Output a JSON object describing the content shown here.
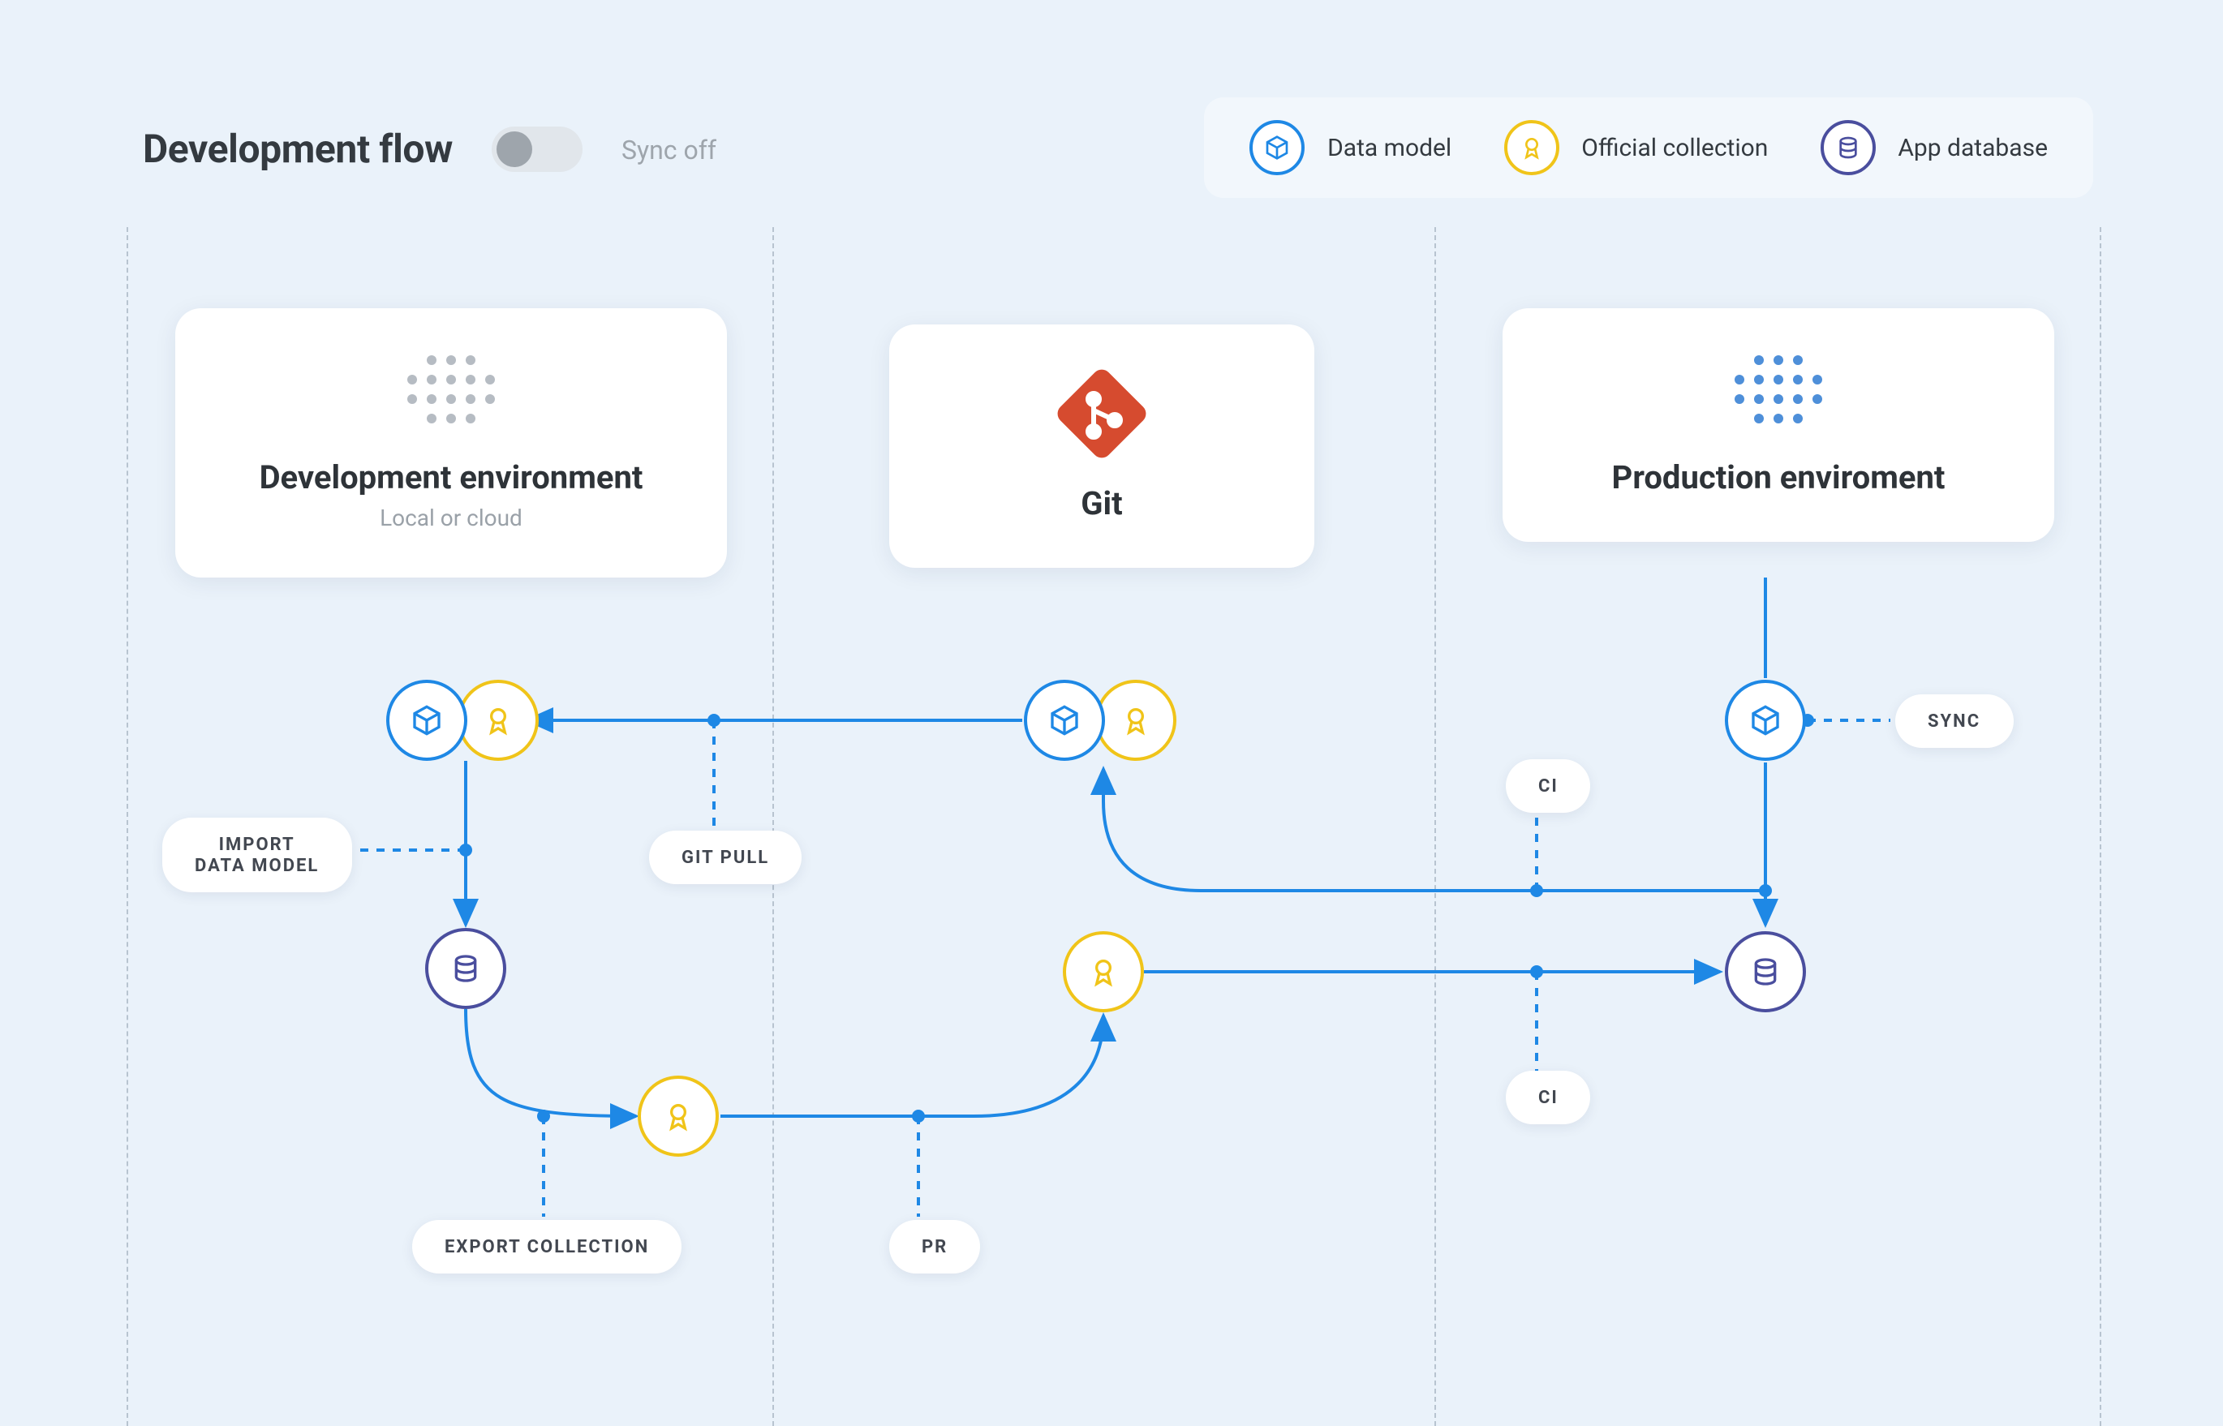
{
  "header": {
    "title": "Development flow",
    "sync_label": "Sync off",
    "sync_on": false
  },
  "legend": {
    "data_model": "Data model",
    "official_collection": "Official collection",
    "app_database": "App database"
  },
  "cards": {
    "dev": {
      "title": "Development environment",
      "subtitle": "Local or cloud"
    },
    "git": {
      "title": "Git"
    },
    "prod": {
      "title": "Production enviroment"
    }
  },
  "labels": {
    "import_data_model": "IMPORT\nDATA MODEL",
    "git_pull": "GIT PULL",
    "export_collection": "EXPORT COLLECTION",
    "pr": "PR",
    "ci_top": "CI",
    "ci_bottom": "CI",
    "sync": "SYNC"
  },
  "colors": {
    "blue": "#1e88e5",
    "yellow": "#f0c419",
    "indigo": "#4a4e9e",
    "git": "#d64b2f",
    "bg": "#eaf2fa"
  },
  "icons": {
    "data_model": "cube-icon",
    "official_collection": "ribbon-icon",
    "app_database": "database-icon",
    "git": "git-icon"
  }
}
